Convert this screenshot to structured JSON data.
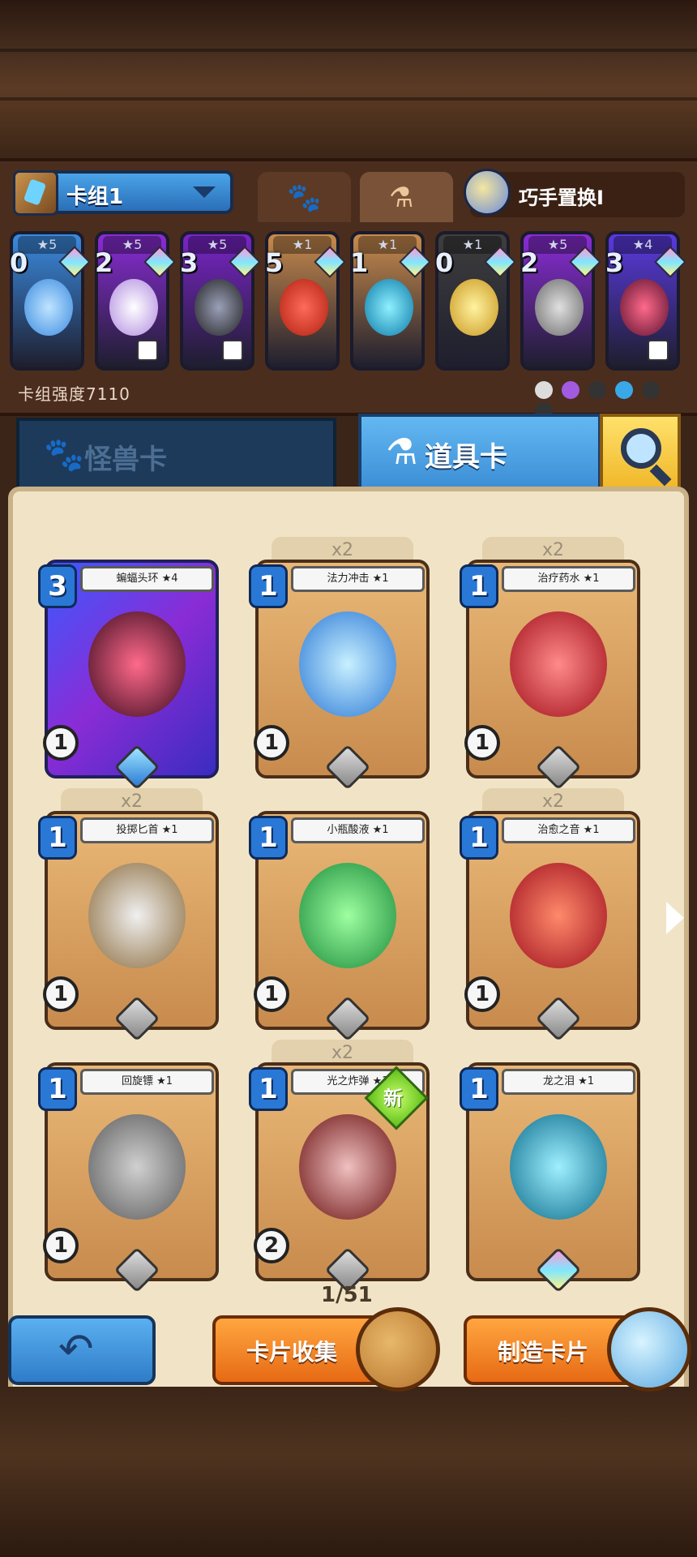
{
  "deck": {
    "name": "卡组1",
    "strength_label": "卡组强度7110",
    "swap_label": "巧手置换I",
    "cards": [
      {
        "stars": "★5",
        "count": "0",
        "color": "#3b8be0"
      },
      {
        "stars": "★5",
        "count": "2",
        "color": "#8a2cd6"
      },
      {
        "stars": "★5",
        "count": "3",
        "color": "#7a24c8"
      },
      {
        "stars": "★1",
        "count": "5",
        "color": "#c88b4d"
      },
      {
        "stars": "★1",
        "count": "1",
        "color": "#c88b4d"
      },
      {
        "stars": "★1",
        "count": "0",
        "color": "#3e3e3e"
      },
      {
        "stars": "★5",
        "count": "2",
        "color": "#8a2cd6"
      },
      {
        "stars": "★4",
        "count": "3",
        "color": "#5a3ae0"
      }
    ]
  },
  "categories": {
    "monster": "怪兽卡",
    "item": "道具卡"
  },
  "cards": [
    {
      "name": "蝙蝠头环 ★4",
      "cost": "3",
      "stat": "1",
      "dup": "",
      "special": true
    },
    {
      "name": "法力冲击 ★1",
      "cost": "1",
      "stat": "1",
      "dup": "x2",
      "special": false
    },
    {
      "name": "治疗药水 ★1",
      "cost": "1",
      "stat": "1",
      "dup": "x2",
      "special": false
    },
    {
      "name": "投掷匕首 ★1",
      "cost": "1",
      "stat": "1",
      "dup": "x2",
      "special": false
    },
    {
      "name": "小瓶酸液 ★1",
      "cost": "1",
      "stat": "1",
      "dup": "",
      "special": false
    },
    {
      "name": "治愈之音 ★1",
      "cost": "1",
      "stat": "1",
      "dup": "x2",
      "special": false
    },
    {
      "name": "回旋镖 ★1",
      "cost": "1",
      "stat": "1",
      "dup": "",
      "special": false
    },
    {
      "name": "光之炸弹 ★1",
      "cost": "1",
      "stat": "2",
      "dup": "x2",
      "special": false
    },
    {
      "name": "龙之泪 ★1",
      "cost": "1",
      "stat": "",
      "dup": "",
      "special": false
    }
  ],
  "new_badge": "新",
  "page_indicator": "1/51",
  "buttons": {
    "collect": "卡片收集",
    "craft": "制造卡片"
  }
}
